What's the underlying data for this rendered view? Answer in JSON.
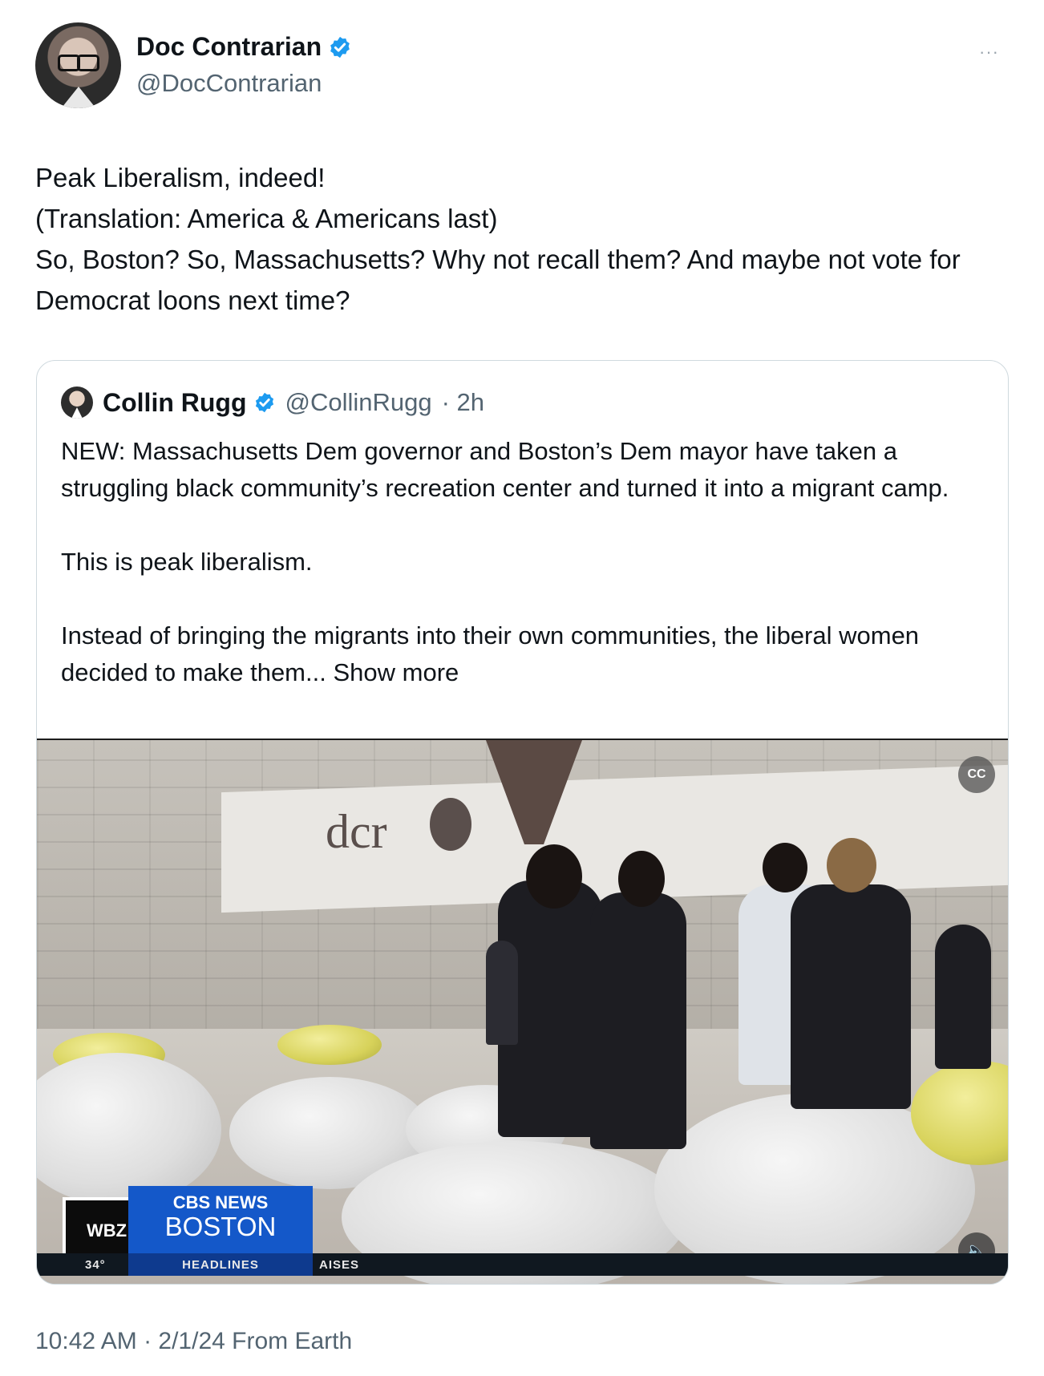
{
  "author": {
    "display_name": "Doc Contrarian",
    "handle": "@DocContrarian"
  },
  "more_label": "···",
  "tweet_text": "Peak Liberalism, indeed!\n(Translation: America & Americans last)\nSo, Boston? So, Massachusetts? Why not recall them? And maybe not vote for Democrat loons next time?",
  "quoted": {
    "display_name": "Collin Rugg",
    "handle": "@CollinRugg",
    "time": "· 2h",
    "text": "NEW: Massachusetts Dem governor and Boston’s Dem mayor have taken a struggling black community’s recreation center and turned it into a migrant camp.\n\nThis is peak liberalism.\n\nInstead of bringing the migrants into their own communities, the liberal women decided to make them... ",
    "show_more": "Show more",
    "media": {
      "sign_text": "dcr",
      "station_logo": "WBZ",
      "network_line1": "CBS NEWS",
      "network_line2": "BOSTON",
      "temperature": "34°",
      "ticker_label": "HEADLINES",
      "ticker_text": "AISES",
      "captions_label": "CC"
    }
  },
  "timestamp": "10:42 AM · 2/1/24 From Earth",
  "colors": {
    "verified": "#1d9bf0",
    "secondary_text": "#536471",
    "border": "#cfd9de"
  }
}
